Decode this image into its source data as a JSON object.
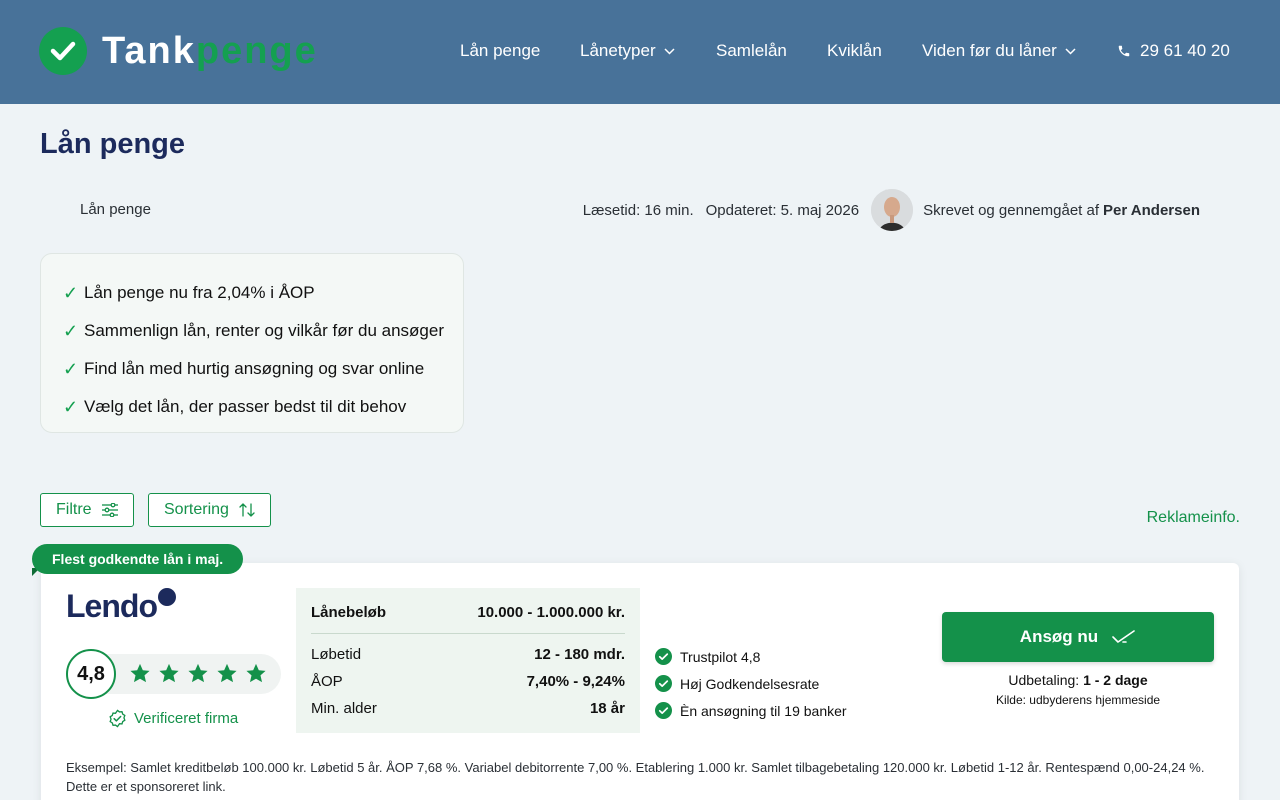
{
  "header": {
    "logo_primary": "Tank",
    "logo_secondary": "penge",
    "nav": [
      {
        "label": "Lån penge"
      },
      {
        "label": "Lånetyper"
      },
      {
        "label": "Samlelån"
      },
      {
        "label": "Kviklån"
      },
      {
        "label": "Viden før du låner"
      }
    ],
    "phone": "29 61 40 20",
    "colors": {
      "background": "#487299",
      "accent": "#14a050"
    }
  },
  "page": {
    "title": "Lån penge",
    "breadcrumb": "Lån penge",
    "read_time": "Læsetid: 16 min.",
    "updated": "Opdateret: 5. maj 2026",
    "author_prefix": "Skrevet og gennemgået af",
    "author": "Per Andersen"
  },
  "benefits": [
    "Lån penge nu fra 2,04% i ÅOP",
    "Sammenlign lån, renter og vilkår før du ansøger",
    "Find lån med hurtig ansøgning og svar online",
    "Vælg det lån, der passer bedst til dit behov"
  ],
  "toolbar": {
    "filter_label": "Filtre",
    "sort_label": "Sortering",
    "ad_info": "Reklameinfo."
  },
  "offer": {
    "badge": "Flest godkendte lån i maj.",
    "lender": "Lendo",
    "rating": "4,8",
    "stars": 5,
    "verified": "Verificeret firma",
    "terms": {
      "amount_label": "Lånebeløb",
      "amount_value": "10.000 - 1.000.000 kr.",
      "rows": [
        {
          "label": "Løbetid",
          "value": "12 - 180 mdr."
        },
        {
          "label": "ÅOP",
          "value": "7,40% - 9,24%"
        },
        {
          "label": "Min. alder",
          "value": "18 år"
        }
      ]
    },
    "features": [
      "Trustpilot 4,8",
      "Høj Godkendelsesrate",
      "Èn ansøgning til 19 banker"
    ],
    "apply_label": "Ansøg nu",
    "payout_label": "Udbetaling:",
    "payout_value": "1 - 2 dage",
    "source": "Kilde: udbyderens hjemmeside",
    "example_line1": "Eksempel: Samlet kreditbeløb 100.000 kr. Løbetid 5 år. ÅOP 7,68 %. Variabel debitorrente 7,00 %. Etablering 1.000 kr. Samlet tilbagebetaling 120.000 kr. Løbetid 1-12 år. Rentespænd 0,00-24,24 %.",
    "example_line2": "Dette er et sponsoreret link."
  }
}
